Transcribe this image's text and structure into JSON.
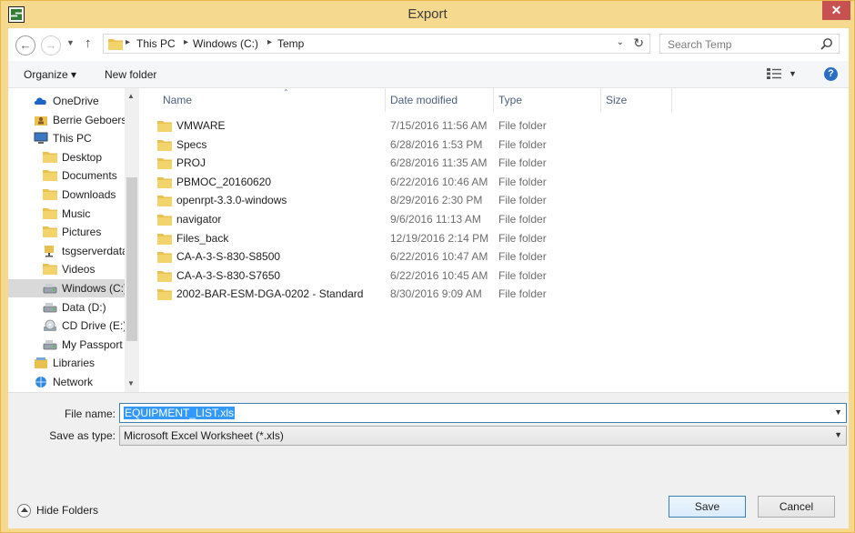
{
  "window": {
    "title": "Export",
    "close_glyph": "✕"
  },
  "address": {
    "crumbs": [
      "This PC",
      "Windows (C:)",
      "Temp"
    ],
    "search_placeholder": "Search Temp"
  },
  "toolbar": {
    "organize_label": "Organize ▾",
    "new_folder_label": "New folder"
  },
  "nav": {
    "items": [
      {
        "label": "OneDrive",
        "icon": "onedrive-icon"
      },
      {
        "label": "Berrie Geboers",
        "icon": "user-folder-icon"
      },
      {
        "label": "This PC",
        "icon": "computer-icon"
      },
      {
        "label": "Desktop",
        "icon": "desktop-folder-icon"
      },
      {
        "label": "Documents",
        "icon": "documents-folder-icon"
      },
      {
        "label": "Downloads",
        "icon": "downloads-folder-icon"
      },
      {
        "label": "Music",
        "icon": "music-folder-icon"
      },
      {
        "label": "Pictures",
        "icon": "pictures-folder-icon"
      },
      {
        "label": "tsgserverdata",
        "icon": "network-drive-icon"
      },
      {
        "label": "Videos",
        "icon": "videos-folder-icon"
      },
      {
        "label": "Windows (C:)",
        "icon": "drive-icon"
      },
      {
        "label": "Data (D:)",
        "icon": "drive-icon"
      },
      {
        "label": "CD Drive (E:) ",
        "icon": "cd-drive-icon"
      },
      {
        "label": "My Passport (",
        "icon": "drive-icon"
      },
      {
        "label": "Libraries",
        "icon": "libraries-icon"
      },
      {
        "label": "Network",
        "icon": "network-icon"
      }
    ],
    "selected_index": 10
  },
  "columns": {
    "name": "Name",
    "date": "Date modified",
    "type": "Type",
    "size": "Size"
  },
  "files": [
    {
      "name": "VMWARE",
      "date": "7/15/2016 11:56 AM",
      "type": "File folder"
    },
    {
      "name": "Specs",
      "date": "6/28/2016 1:53 PM",
      "type": "File folder"
    },
    {
      "name": "PROJ",
      "date": "6/28/2016 11:35 AM",
      "type": "File folder"
    },
    {
      "name": "PBMOC_20160620",
      "date": "6/22/2016 10:46 AM",
      "type": "File folder"
    },
    {
      "name": "openrpt-3.3.0-windows",
      "date": "8/29/2016 2:30 PM",
      "type": "File folder"
    },
    {
      "name": "navigator",
      "date": "9/6/2016 11:13 AM",
      "type": "File folder"
    },
    {
      "name": "Files_back",
      "date": "12/19/2016 2:14 PM",
      "type": "File folder"
    },
    {
      "name": "CA-A-3-S-830-S8500",
      "date": "6/22/2016 10:47 AM",
      "type": "File folder"
    },
    {
      "name": "CA-A-3-S-830-S7650",
      "date": "6/22/2016 10:45 AM",
      "type": "File folder"
    },
    {
      "name": "2002-BAR-ESM-DGA-0202 - Standard",
      "date": "8/30/2016 9:09 AM",
      "type": "File folder"
    }
  ],
  "form": {
    "file_name_label": "File name:",
    "file_name_value": "EQUIPMENT_LIST.xls",
    "save_type_label": "Save as type:",
    "save_type_value": "Microsoft Excel Worksheet (*.xls)"
  },
  "footer": {
    "hide_folders_label": "Hide Folders",
    "save_label": "Save",
    "cancel_label": "Cancel"
  },
  "colors": {
    "frame": "#f5d98e",
    "close": "#c75050",
    "folder": "#e8c14e",
    "selection": "#3399ff",
    "accent_border": "#3c7fb1"
  }
}
